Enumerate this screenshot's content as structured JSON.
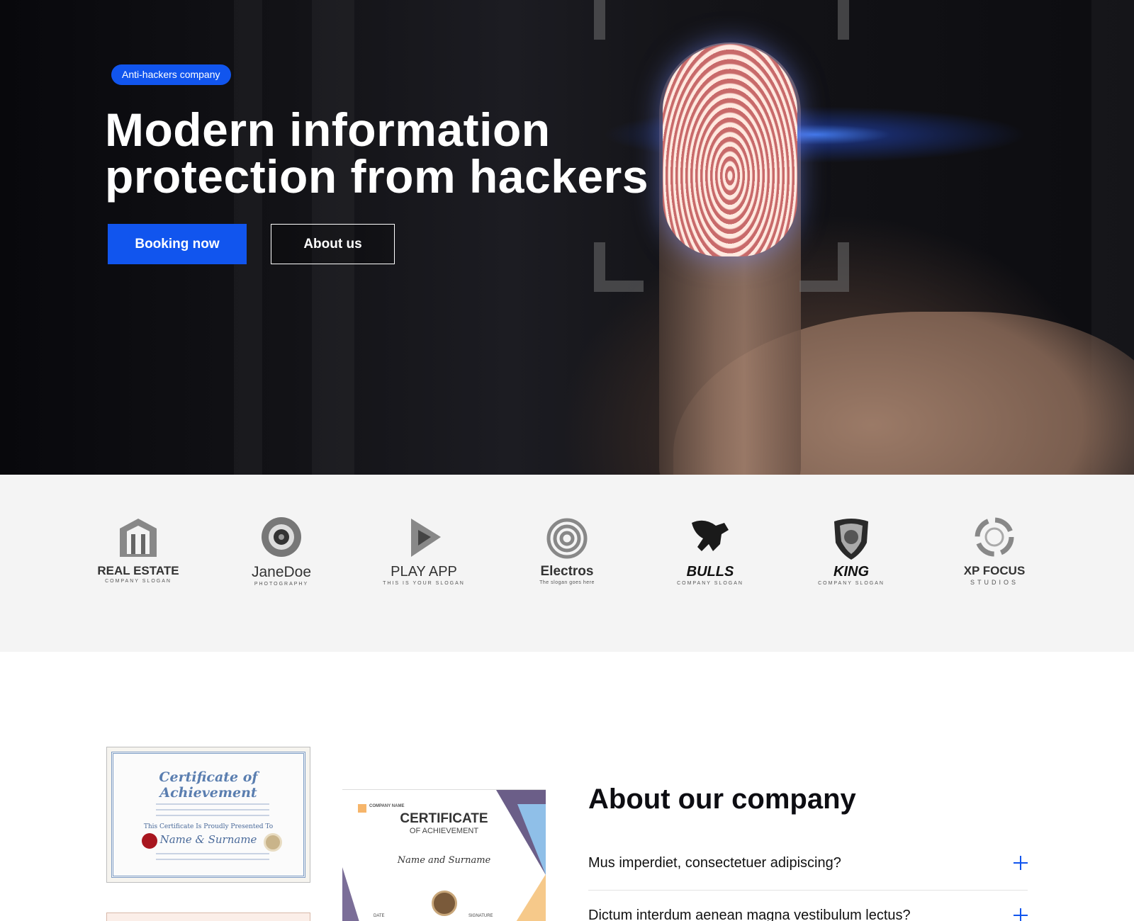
{
  "hero": {
    "badge": "Anti-hackers company",
    "title": "Modern information protection from hackers",
    "primary_button": "Booking now",
    "secondary_button": "About us"
  },
  "logos": [
    {
      "name": "REAL ESTATE",
      "sub": "COMPANY SLOGAN",
      "icon": "building-logo-icon"
    },
    {
      "name": "JaneDoe",
      "sub": "PHOTOGRAPHY",
      "icon": "camera-lens-logo-icon"
    },
    {
      "name": "PLAY APP",
      "sub": "THIS IS YOUR SLOGAN",
      "icon": "play-logo-icon"
    },
    {
      "name": "Electros",
      "sub": "The slogan goes here",
      "icon": "spiral-logo-icon"
    },
    {
      "name": "BULLS",
      "sub": "COMPANY SLOGAN",
      "icon": "bull-logo-icon"
    },
    {
      "name": "KING",
      "sub": "COMPANY SLOGAN",
      "icon": "lion-shield-logo-icon"
    },
    {
      "name": "XP FOCUS",
      "sub": "STUDIOS",
      "icon": "focus-ring-logo-icon"
    }
  ],
  "certificates": {
    "first": {
      "title": "Certificate of Achievement",
      "presented": "This Certificate Is Proudly Presented To",
      "name": "Name & Surname"
    },
    "second": {
      "company": "COMPANY NAME",
      "title": "CERTIFICATE",
      "subtitle": "OF ACHIEVEMENT",
      "name": "Name and Surname",
      "date_label": "DATE",
      "signature_label": "SIGNATURE"
    }
  },
  "about": {
    "title": "About our company",
    "faq": [
      {
        "question": "Mus imperdiet, consectetuer adipiscing?"
      },
      {
        "question": "Dictum interdum aenean magna vestibulum lectus?"
      }
    ]
  },
  "colors": {
    "accent": "#1155ee",
    "logo_strip_bg": "#f4f4f4"
  }
}
